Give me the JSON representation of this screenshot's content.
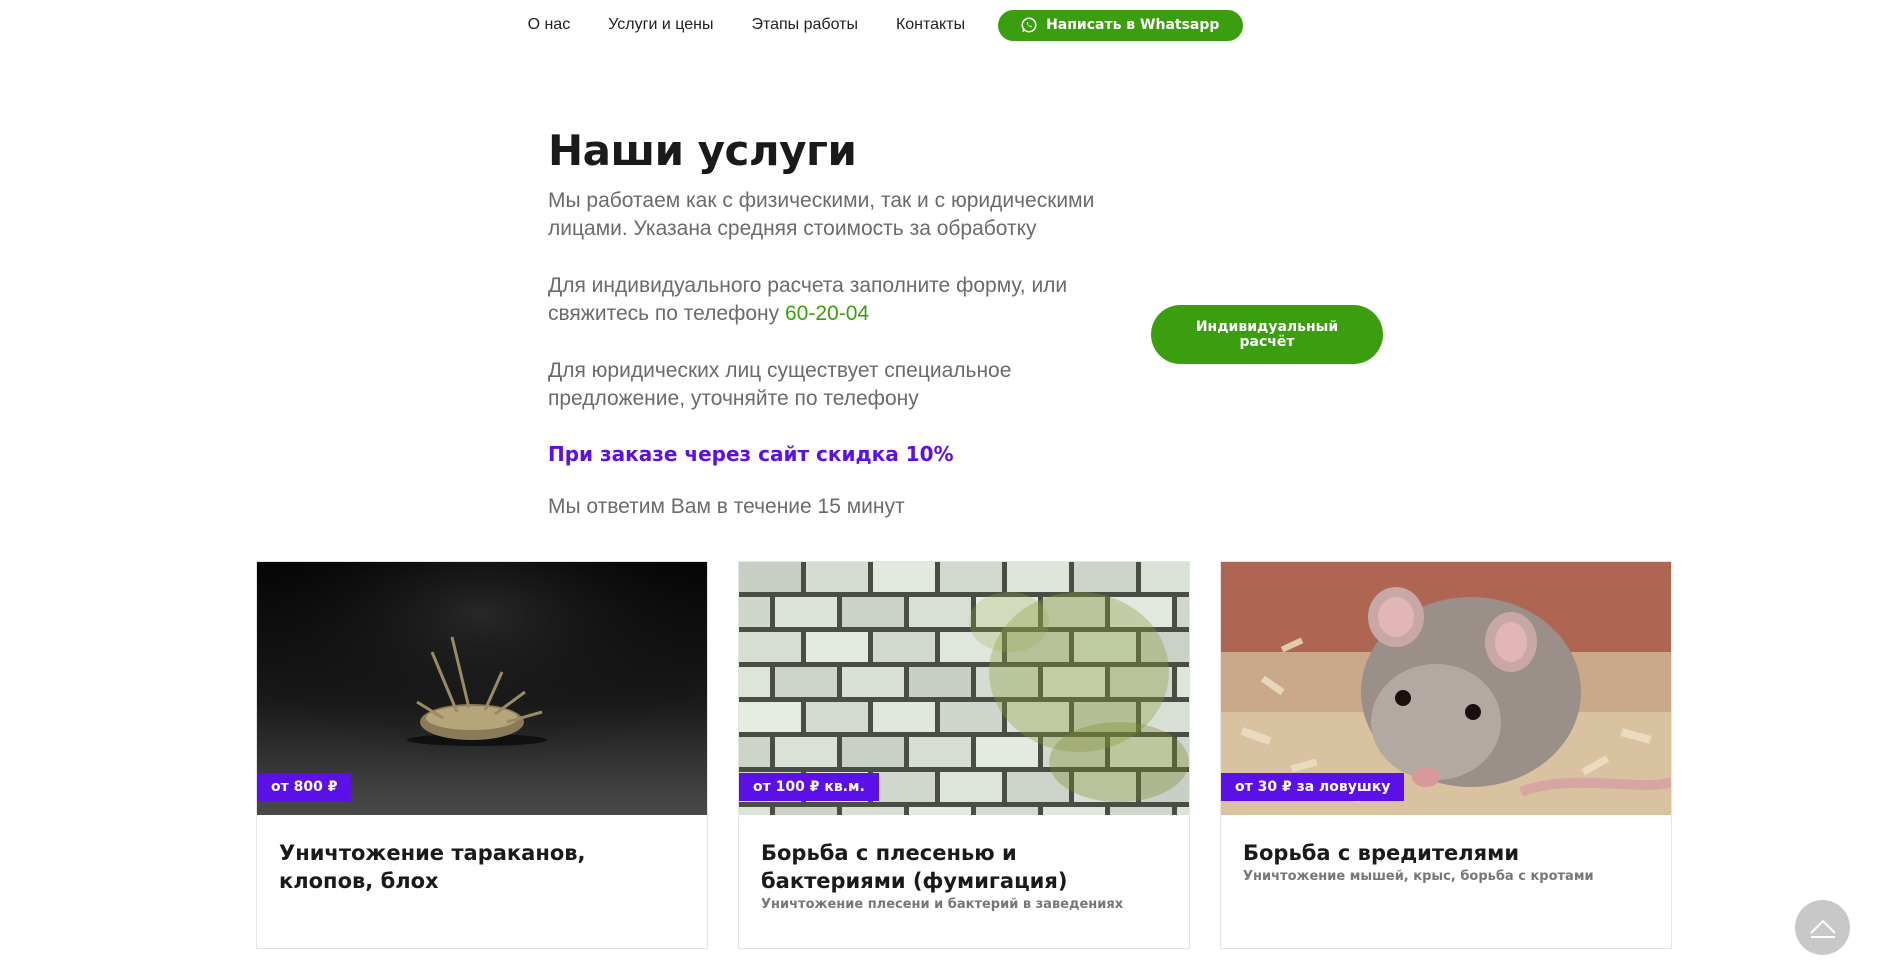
{
  "nav": {
    "items": [
      {
        "label": "О нас"
      },
      {
        "label": "Услуги и цены"
      },
      {
        "label": "Этапы работы"
      },
      {
        "label": "Контакты"
      }
    ],
    "whatsapp_label": "Написать в Whatsapp",
    "whatsapp_icon": "whatsapp-icon"
  },
  "intro": {
    "title": "Наши услуги",
    "p1": "Мы работаем как с физическими, так и с юридическими лицами. Указана средняя стоимость за обработку",
    "p2_text": "Для индивидуального расчета заполните форму, или свяжитесь по телефону ",
    "p2_phone": "60-20-04",
    "p3": "Для юридических лиц существует специальное предложение, уточняйте по телефону",
    "discount": "При заказе через сайт скидка 10%",
    "p4": "Мы ответим Вам в течение 15 минут",
    "calc_button": "Индивидуальный расчёт"
  },
  "cards": [
    {
      "price": "от 800 ₽",
      "title": "Уничтожение тараканов, клопов, блох",
      "subtitle": ""
    },
    {
      "price": "от 100 ₽ кв.м.",
      "title": "Борьба с плесенью и бактериями (фумигация)",
      "subtitle": "Уничтожение плесени и бактерий в заведениях"
    },
    {
      "price": "от 30 ₽ за ловушку",
      "title": "Борьба с вредителями",
      "subtitle": "Уничтожение мышей, крыс, борьба с кротами"
    }
  ],
  "colors": {
    "accent_green": "#3a9e0e",
    "accent_purple": "#5a10e6"
  },
  "scroll_up_icon": "arrow-up-icon"
}
